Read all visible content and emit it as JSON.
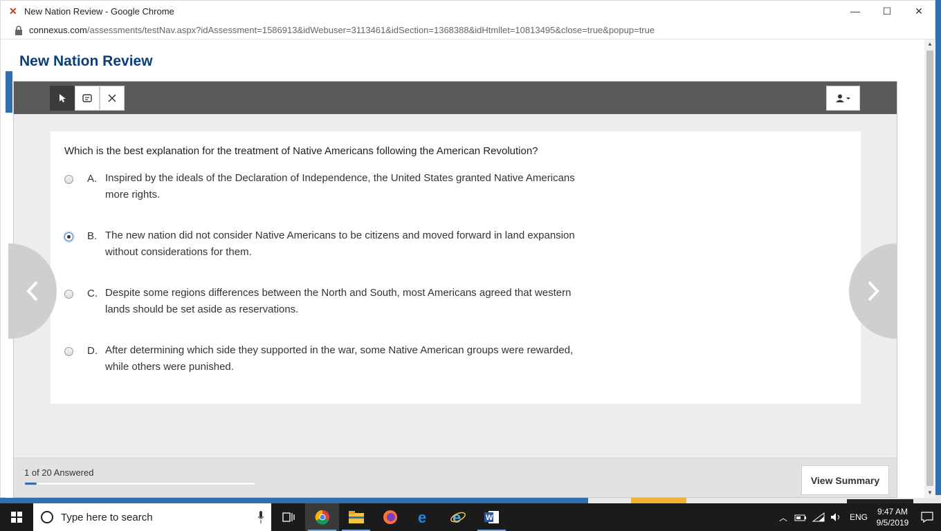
{
  "window": {
    "title": "New Nation Review - Google Chrome",
    "url_host": "connexus.com",
    "url_path": "/assessments/testNav.aspx?idAssessment=1586913&idWebuser=3113461&idSection=1368388&idHtmllet=10813495&close=true&popup=true"
  },
  "page": {
    "title": "New Nation Review"
  },
  "toolbar": {
    "tools": [
      "pointer-icon",
      "note-icon",
      "eliminate-icon"
    ],
    "user_menu": "user-icon"
  },
  "question": {
    "prompt": "Which is the best explanation for the treatment of Native Americans following the American Revolution?",
    "choices": [
      {
        "letter": "A.",
        "text": "Inspired by the ideals of the Declaration of Independence, the United States granted Native Americans more rights.",
        "selected": false
      },
      {
        "letter": "B.",
        "text": "The new nation did not consider Native Americans to be citizens and moved forward in land expansion without considerations for them.",
        "selected": true
      },
      {
        "letter": "C.",
        "text": "Despite some regions differences between the North and South, most Americans agreed that western lands should be set aside as reservations.",
        "selected": false
      },
      {
        "letter": "D.",
        "text": "After determining which side they supported in the war, some Native American groups were rewarded, while others were punished.",
        "selected": false
      }
    ]
  },
  "footer": {
    "answered": "1 of 20 Answered",
    "progress": 0.05,
    "summary_label": "View Summary"
  },
  "taskbar": {
    "search_placeholder": "Type here to search",
    "language": "ENG",
    "time": "9:47 AM",
    "date": "9/5/2019"
  },
  "colors": {
    "title_blue": "#0b3d7a",
    "accent_blue": "#2f6fb0",
    "toolbar_gray": "#5a5a5a"
  }
}
